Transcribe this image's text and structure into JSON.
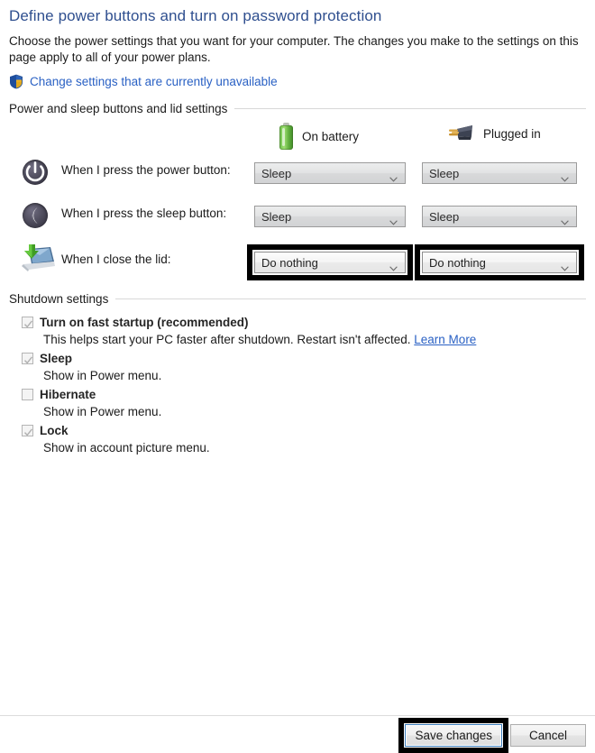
{
  "header": {
    "title": "Define power buttons and turn on password protection",
    "intro": "Choose the power settings that you want for your computer. The changes you make to the settings on this page apply to all of your power plans.",
    "uac_link": "Change settings that are currently unavailable",
    "shield_icon": "uac-shield-icon"
  },
  "power_section": {
    "group_label": "Power and sleep buttons and lid settings",
    "columns": [
      {
        "label": "On battery",
        "icon": "battery-icon"
      },
      {
        "label": "Plugged in",
        "icon": "power-plug-icon"
      }
    ],
    "rows": [
      {
        "icon": "power-button-icon",
        "label": "When I press the power button:",
        "on_battery": "Sleep",
        "plugged_in": "Sleep",
        "enabled": false,
        "highlighted": false
      },
      {
        "icon": "sleep-button-icon",
        "label": "When I press the sleep button:",
        "on_battery": "Sleep",
        "plugged_in": "Sleep",
        "enabled": false,
        "highlighted": false
      },
      {
        "icon": "laptop-lid-icon",
        "label": "When I close the lid:",
        "on_battery": "Do nothing",
        "plugged_in": "Do nothing",
        "enabled": true,
        "highlighted": true
      }
    ]
  },
  "shutdown_section": {
    "group_label": "Shutdown settings",
    "items": [
      {
        "title": "Turn on fast startup (recommended)",
        "description": "This helps start your PC faster after shutdown. Restart isn't affected.",
        "link": "Learn More",
        "checked": true
      },
      {
        "title": "Sleep",
        "description": "Show in Power menu.",
        "link": "",
        "checked": true
      },
      {
        "title": "Hibernate",
        "description": "Show in Power menu.",
        "link": "",
        "checked": false
      },
      {
        "title": "Lock",
        "description": "Show in account picture menu.",
        "link": "",
        "checked": true
      }
    ]
  },
  "footer": {
    "save_label": "Save changes",
    "cancel_label": "Cancel"
  },
  "colors": {
    "title_blue": "#2f4f8f",
    "link_blue": "#2a61c4",
    "highlight_black": "#000000",
    "battery_green": "#6cbf4a",
    "focus_blue": "#3d7ebd"
  }
}
